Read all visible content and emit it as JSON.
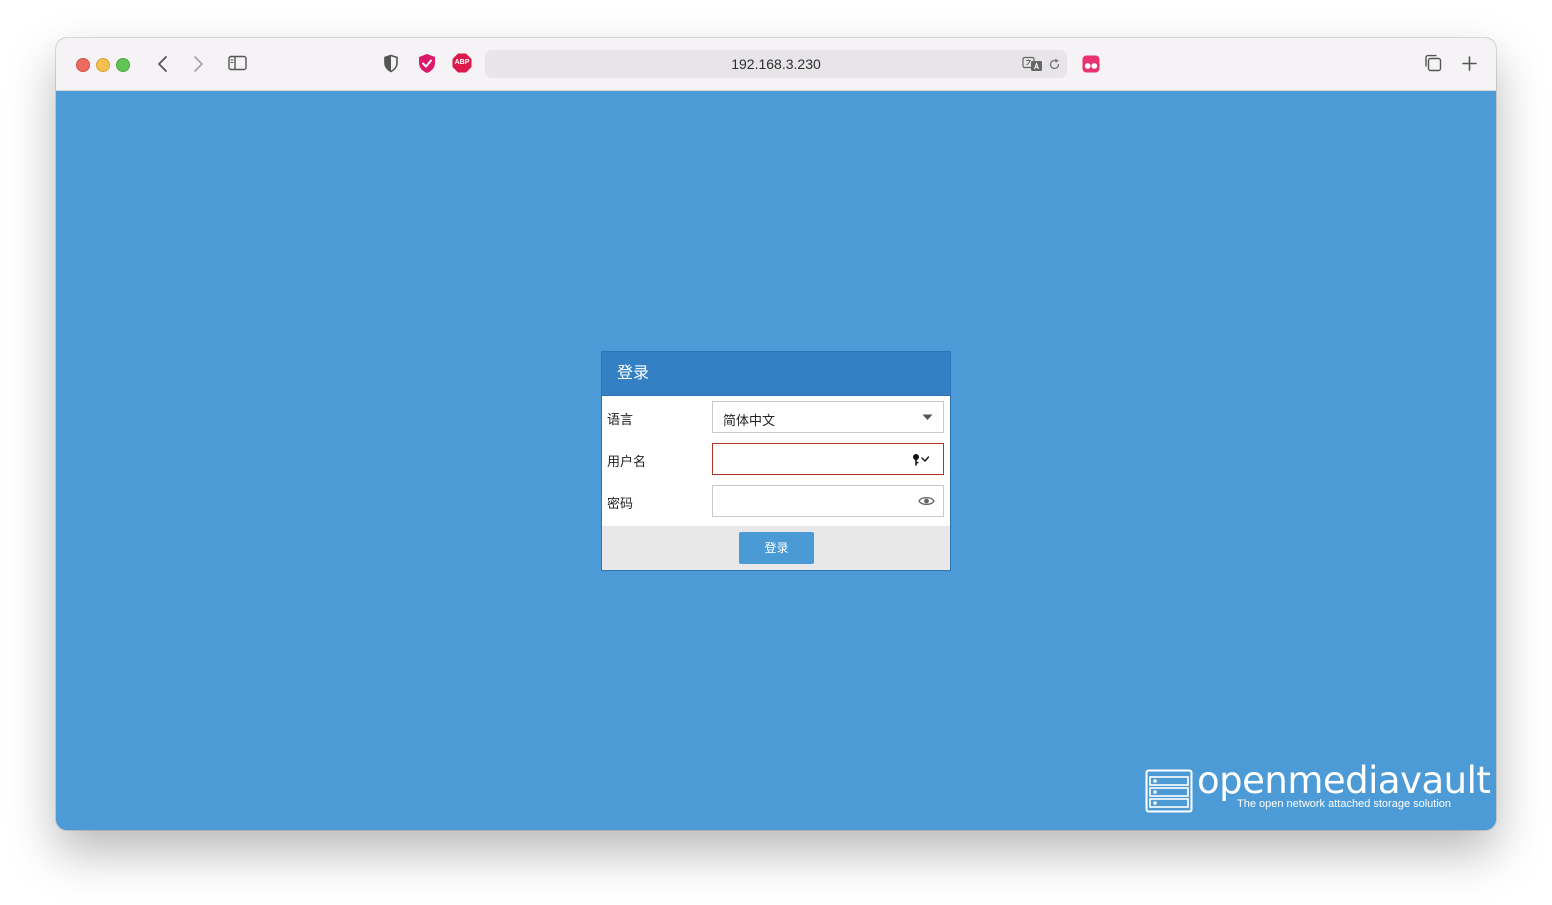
{
  "browser": {
    "address": "192.168.3.230",
    "icons": [
      "back-icon",
      "forward-icon",
      "sidebar-icon",
      "shield-icon",
      "extension-check-icon",
      "adblock-plus-icon",
      "translate-icon",
      "reload-icon",
      "extension-dots-icon",
      "tabs-overview-icon",
      "new-tab-icon"
    ],
    "adblock_label": "ABP"
  },
  "dialog": {
    "title": "登录",
    "language_label": "语言",
    "language_value": "简体中文",
    "username_label": "用户名",
    "username_value": "",
    "password_label": "密码",
    "password_value": "",
    "login_button": "登录"
  },
  "branding": {
    "name": "openmediavault",
    "tagline": "The open network attached storage solution"
  },
  "colors": {
    "page_background": "#4c9bd6",
    "dialog_header": "#3381c4",
    "invalid_border": "#b13222",
    "button": "#4a9ad6"
  }
}
